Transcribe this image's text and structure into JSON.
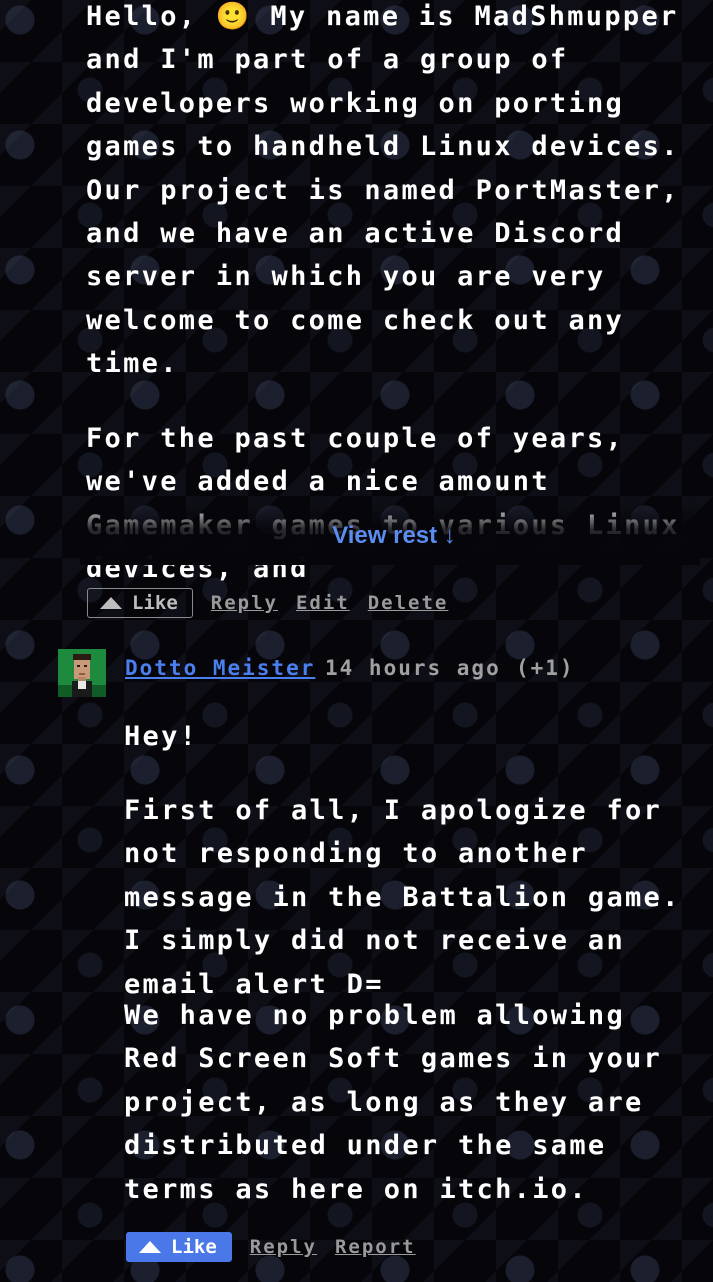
{
  "post": {
    "paragraph1": " Hello, 🙂 My name is MadShmupper and I'm part of a group of developers working on porting games to handheld Linux devices. Our project is named PortMaster, and we have an active Discord server in which you are very welcome to come check out any time.",
    "paragraph2": " For the past couple of years, we've added a nice amount Gamemaker games to various Linux devices, and",
    "view_rest": "View rest ↓",
    "actions": {
      "like": "Like",
      "reply": "Reply",
      "edit": "Edit",
      "delete": "Delete"
    }
  },
  "reply": {
    "author": "Dotto Meister",
    "time": "14 hours ago",
    "score": "(+1)",
    "paragraphs": [
      "Hey!",
      "First of all, I apologize for not responding to another message in the Battalion game. I simply did not receive an email alert D=",
      "We have no problem allowing Red Screen Soft games in your project, as long as they are distributed under the same terms as here on itch.io."
    ],
    "actions": {
      "like": "Like",
      "reply": "Reply",
      "report": "Report"
    }
  },
  "colors": {
    "link": "#4a7ff0",
    "like_filled": "#4a78e8",
    "muted": "#9a9a9a"
  },
  "icons": [
    "upvote-triangle-icon",
    "avatar-pixel-portrait"
  ]
}
